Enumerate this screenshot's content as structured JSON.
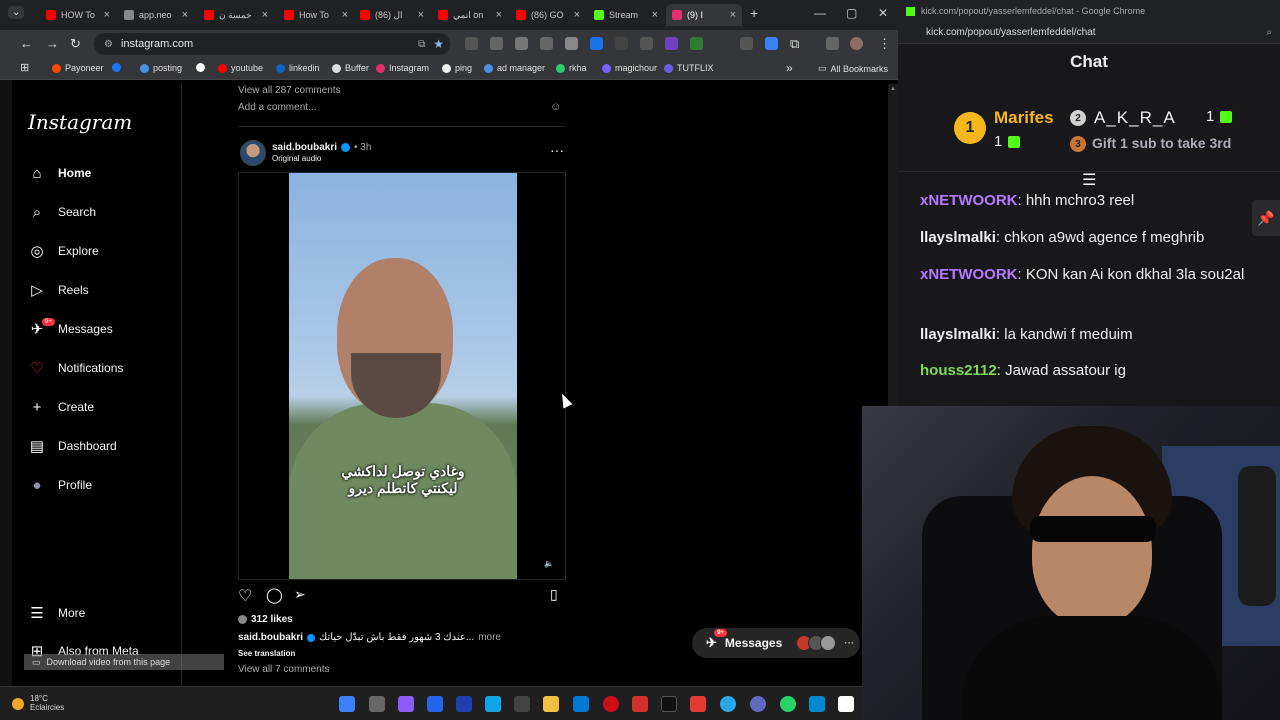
{
  "left_browser": {
    "tabs": [
      {
        "label": "HOW To",
        "color": "#ff0000"
      },
      {
        "label": "app.neo",
        "color": "#888888"
      },
      {
        "label": "خمسة ن",
        "color": "#ff0000"
      },
      {
        "label": "How To",
        "color": "#ff0000"
      },
      {
        "label": "(86) ال",
        "color": "#ff0000"
      },
      {
        "label": "انمي on",
        "color": "#ff0000"
      },
      {
        "label": "(86) GO",
        "color": "#ff0000"
      },
      {
        "label": "Stream",
        "color": "#53fc18"
      },
      {
        "label": "(9) I",
        "color": "#e1306c",
        "active": true
      }
    ],
    "new_tab": "+",
    "window_controls": [
      "—",
      "▢",
      "✕"
    ],
    "address": "instagram.com",
    "bookmarks": [
      {
        "label": "Payoneer",
        "color": "#ff4800"
      },
      {
        "label": "",
        "color": "#1877f2"
      },
      {
        "label": "posting",
        "color": "#4a90e2"
      },
      {
        "label": "",
        "color": "#ffffff"
      },
      {
        "label": "youtube",
        "color": "#ff0000"
      },
      {
        "label": "linkedin",
        "color": "#0a66c2"
      },
      {
        "label": "Buffer",
        "color": "#dddddd"
      },
      {
        "label": "Instagram",
        "color": "#e1306c"
      },
      {
        "label": "ping",
        "color": "#eeeeee"
      },
      {
        "label": "ad manager",
        "color": "#4a90e2"
      },
      {
        "label": "rkha",
        "color": "#2ecc71"
      },
      {
        "label": "magichour",
        "color": "#7b61ff"
      },
      {
        "label": "TUTFLIX",
        "color": "#6c5ce7"
      }
    ],
    "bookmarks_more": "»",
    "all_bookmarks": "All Bookmarks"
  },
  "instagram": {
    "logo": "Instagram",
    "nav": [
      {
        "label": "Home",
        "icon": "⌂",
        "active": true
      },
      {
        "label": "Search",
        "icon": "⌕"
      },
      {
        "label": "Explore",
        "icon": "◎"
      },
      {
        "label": "Reels",
        "icon": "▷"
      },
      {
        "label": "Messages",
        "icon": "✈",
        "badge": "9+"
      },
      {
        "label": "Notifications",
        "icon": "♡"
      },
      {
        "label": "Create",
        "icon": "+"
      },
      {
        "label": "Dashboard",
        "icon": "▤"
      },
      {
        "label": "Profile",
        "icon": "●"
      }
    ],
    "more": "More",
    "also_from_meta": "Also from Meta",
    "prev_post": {
      "view_comments": "View all 287 comments",
      "add_comment": "Add a comment..."
    },
    "post": {
      "username": "said.boubakri",
      "time": "• 3h",
      "audio": "Original audio",
      "subtitle_line1": "وغادي توصل لداكشي",
      "subtitle_line2": "ليكنتي كاتطلم ديرو",
      "likes": "312 likes",
      "caption": "عندك 3 شهور فقط باش تبدّل حياتك...",
      "more": "more",
      "see_translation": "See translation",
      "view_comments": "View all 7 comments"
    },
    "messages_pill": {
      "label": "Messages",
      "badge": "9+"
    }
  },
  "download_bar": "Download video from this page",
  "chat_window": {
    "title_url": "kick.com/popout/yasserlemfeddel/chat - Google Chrome",
    "url": "kick.com/popout/yasserlemfeddel/chat",
    "header": "Chat",
    "gifters": {
      "first": {
        "rank": "1",
        "name": "Marifes",
        "count": "1"
      },
      "second": {
        "rank": "2",
        "name": "A_K_R_A",
        "count": "1"
      },
      "third": {
        "rank": "3",
        "text": "Gift 1 sub to take 3rd"
      }
    },
    "messages": [
      {
        "user": "xNETWOORK",
        "color": "#b57aff",
        "text": "hhh mchro3 reel"
      },
      {
        "user": "llayslmalki",
        "color": "#efeff1",
        "text": "chkon a9wd agence f meghrib"
      },
      {
        "user": "xNETWOORK",
        "color": "#b57aff",
        "text": "KON kan Ai kon dkhal 3la sou2al"
      },
      {
        "user": "llayslmalki",
        "color": "#efeff1",
        "text": "la kandwi f meduim"
      },
      {
        "user": "houss2112",
        "color": "#7ed957",
        "text": "Jawad assatour ig"
      }
    ]
  },
  "taskbar": {
    "temperature": "18°C",
    "weather": "Eclaircies"
  }
}
